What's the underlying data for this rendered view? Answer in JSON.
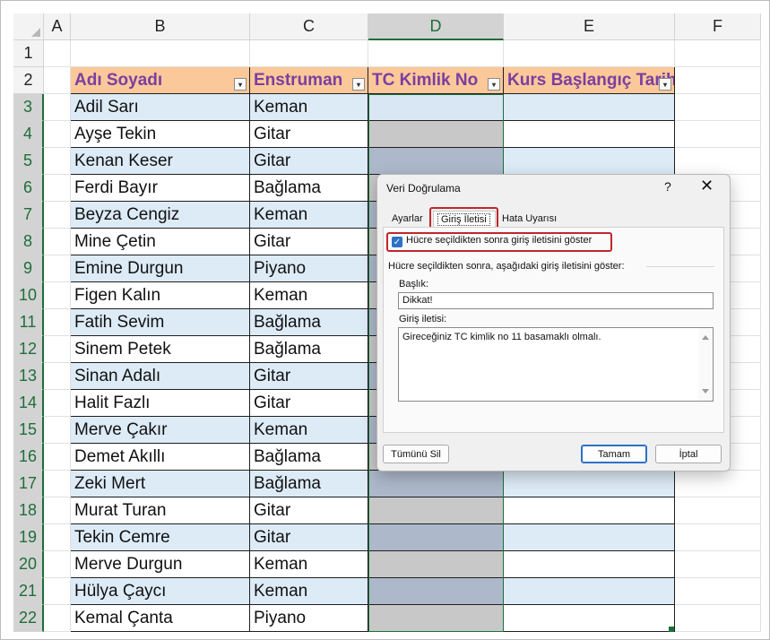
{
  "sheet": {
    "columns": [
      "A",
      "B",
      "C",
      "D",
      "E",
      "F"
    ],
    "row_numbers": [
      "1",
      "2",
      "3",
      "4",
      "5",
      "6",
      "7",
      "8",
      "9",
      "10",
      "11",
      "12",
      "13",
      "14",
      "15",
      "16",
      "17",
      "18",
      "19",
      "20",
      "21",
      "22"
    ],
    "headers": {
      "name": "Adı Soyadı",
      "instrument": "Enstruman",
      "tc": "TC Kimlik No",
      "start": "Kurs Başlangıç Tarihi",
      "filter_glyph": "▾"
    },
    "rows": [
      {
        "name": "Adil Sarı",
        "instrument": "Keman"
      },
      {
        "name": "Ayşe Tekin",
        "instrument": "Gitar"
      },
      {
        "name": "Kenan Keser",
        "instrument": "Gitar"
      },
      {
        "name": "Ferdi Bayır",
        "instrument": "Bağlama"
      },
      {
        "name": "Beyza Cengiz",
        "instrument": "Keman"
      },
      {
        "name": "Mine Çetin",
        "instrument": "Gitar"
      },
      {
        "name": "Emine Durgun",
        "instrument": "Piyano"
      },
      {
        "name": "Figen Kalın",
        "instrument": "Keman"
      },
      {
        "name": "Fatih Sevim",
        "instrument": "Bağlama"
      },
      {
        "name": "Sinem Petek",
        "instrument": "Bağlama"
      },
      {
        "name": "Sinan Adalı",
        "instrument": "Gitar"
      },
      {
        "name": "Halit Fazlı",
        "instrument": "Gitar"
      },
      {
        "name": "Merve Çakır",
        "instrument": "Keman"
      },
      {
        "name": "Demet Akıllı",
        "instrument": "Bağlama"
      },
      {
        "name": "Zeki Mert",
        "instrument": "Bağlama"
      },
      {
        "name": "Murat Turan",
        "instrument": "Gitar"
      },
      {
        "name": "Tekin Cemre",
        "instrument": "Gitar"
      },
      {
        "name": "Merve Durgun",
        "instrument": "Keman"
      },
      {
        "name": "Hülya Çaycı",
        "instrument": "Keman"
      },
      {
        "name": "Kemal Çanta",
        "instrument": "Piyano"
      }
    ]
  },
  "dialog": {
    "title": "Veri Doğrulama",
    "help": "?",
    "close": "✕",
    "tabs": [
      "Ayarlar",
      "Giriş İletisi",
      "Hata Uyarısı"
    ],
    "checkbox_label": "Hücre seçildikten sonra giriş iletisini göster",
    "checkbox_checked": true,
    "section_label": "Hücre seçildikten sonra, aşağıdaki giriş iletisini göster:",
    "title_label": "Başlık:",
    "title_value": "Dikkat!",
    "message_label": "Giriş iletisi:",
    "message_value": "Gireceğiniz TC kimlik no 11 basamaklı olmalı.",
    "clear_all": "Tümünü Sil",
    "ok": "Tamam",
    "cancel": "İptal"
  },
  "colors": {
    "header_fill": "#fbc89a",
    "header_text": "#7a3fa0",
    "band_fill": "#ddebf7",
    "selection": "#1e6e3a",
    "highlight_box": "#c0262d",
    "checkbox": "#2b72c6"
  }
}
